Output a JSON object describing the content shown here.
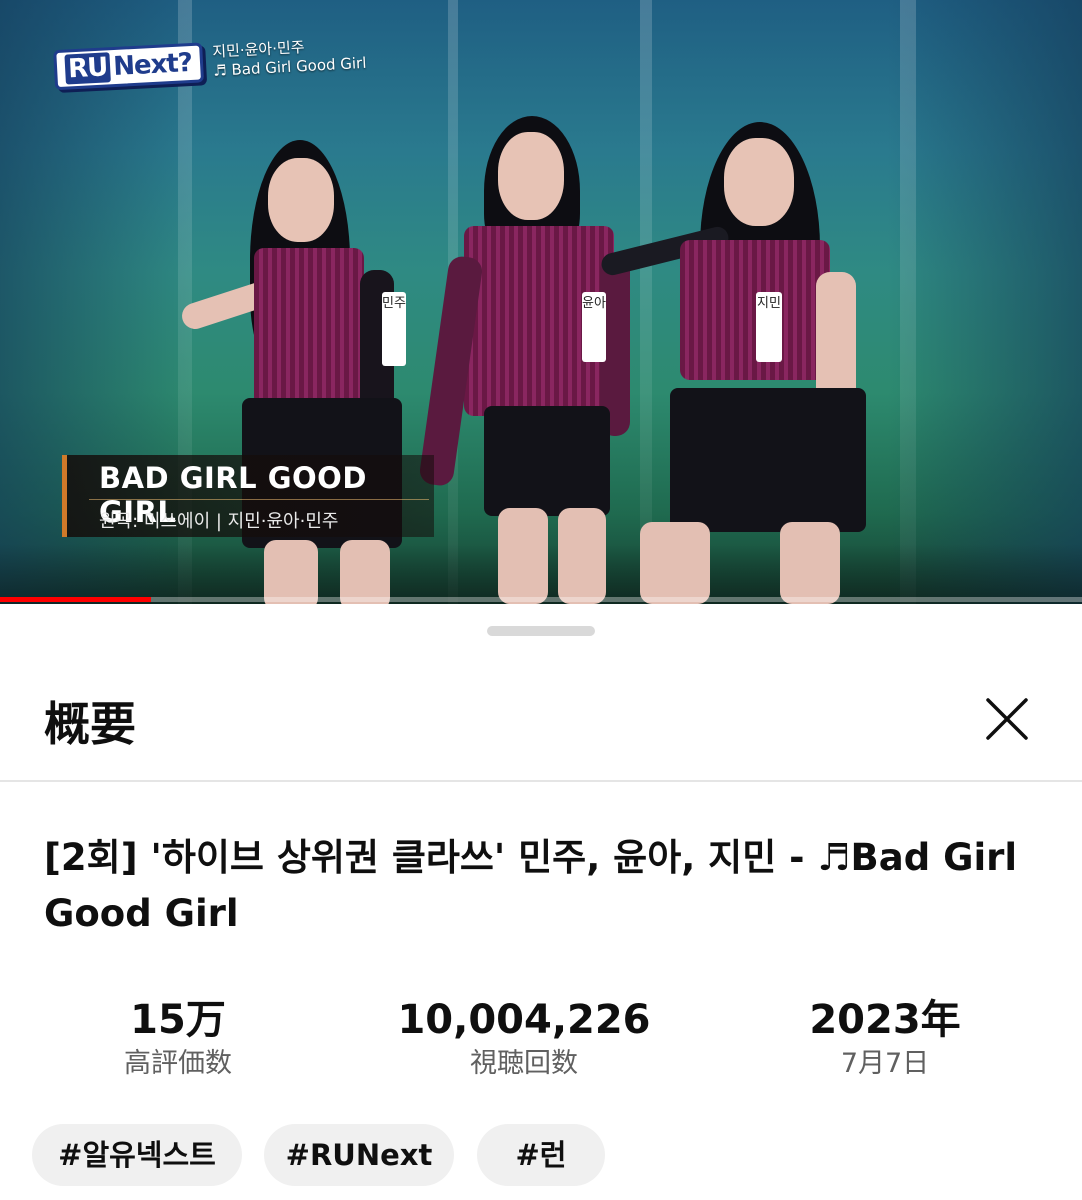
{
  "video": {
    "logo_text": "RUNext?",
    "logo_ru": "RU",
    "logo_next": "Next?",
    "overlay_members": "지민·윤아·민주",
    "overlay_song": "♬ Bad Girl Good Girl",
    "song_title": "BAD GIRL GOOD GIRL",
    "song_credit": "원곡: 미쓰에이 | 지민·윤아·민주",
    "name_tags": [
      "민주",
      "윤아",
      "지민"
    ],
    "progress": 0.14
  },
  "sheet": {
    "title": "概要",
    "close_icon": "close-icon"
  },
  "description": {
    "title": "[2회] '하이브 상위권 클라쓰' 민주, 윤아, 지민 - ♬Bad Girl Good Girl",
    "stats": [
      {
        "value": "15万",
        "label": "高評価数"
      },
      {
        "value": "10,004,226",
        "label": "視聴回数"
      },
      {
        "value": "2023年",
        "label": "7月7日"
      }
    ],
    "tags": [
      "#알유넥스트",
      "#RUNext",
      "#런"
    ]
  },
  "colors": {
    "progress": "#ff0000",
    "tag_bg": "#f0f0f0",
    "caption_accent": "#d07a2a"
  }
}
